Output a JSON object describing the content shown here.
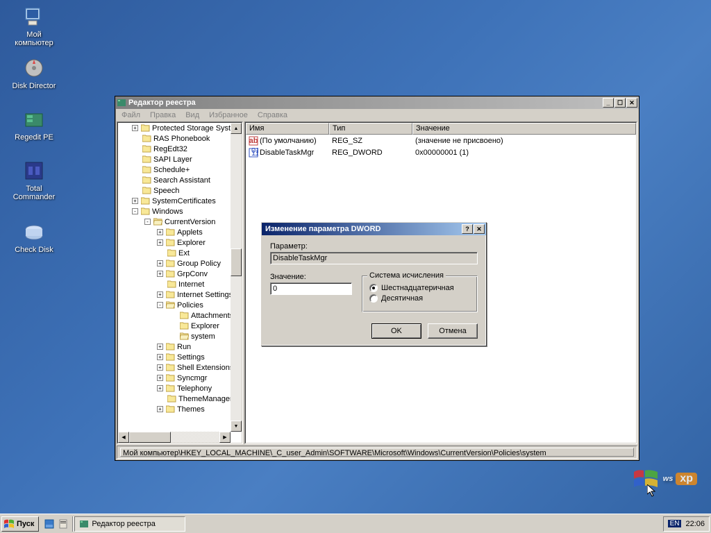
{
  "desktop_icons": [
    {
      "id": "my-computer",
      "label": "Мой\nкомпьютер"
    },
    {
      "id": "disk-director",
      "label": "Disk Director"
    },
    {
      "id": "regedit-pe",
      "label": "Regedit PE"
    },
    {
      "id": "total-commander",
      "label": "Total\nCommander"
    },
    {
      "id": "check-disk",
      "label": "Check Disk"
    }
  ],
  "regedit": {
    "title": "Редактор реестра",
    "menu": [
      "Файл",
      "Правка",
      "Вид",
      "Избранное",
      "Справка"
    ],
    "tree": [
      {
        "pad": 20,
        "exp": "+",
        "label": "Protected Storage System"
      },
      {
        "pad": 20,
        "exp": "",
        "label": "RAS Phonebook"
      },
      {
        "pad": 20,
        "exp": "",
        "label": "RegEdt32"
      },
      {
        "pad": 20,
        "exp": "",
        "label": "SAPI Layer"
      },
      {
        "pad": 20,
        "exp": "",
        "label": "Schedule+"
      },
      {
        "pad": 20,
        "exp": "",
        "label": "Search Assistant"
      },
      {
        "pad": 20,
        "exp": "",
        "label": "Speech"
      },
      {
        "pad": 20,
        "exp": "+",
        "label": "SystemCertificates"
      },
      {
        "pad": 20,
        "exp": "-",
        "label": "Windows"
      },
      {
        "pad": 38,
        "exp": "-",
        "label": "CurrentVersion",
        "open": true
      },
      {
        "pad": 56,
        "exp": "+",
        "label": "Applets"
      },
      {
        "pad": 56,
        "exp": "+",
        "label": "Explorer"
      },
      {
        "pad": 56,
        "exp": "",
        "label": "Ext"
      },
      {
        "pad": 56,
        "exp": "+",
        "label": "Group Policy"
      },
      {
        "pad": 56,
        "exp": "+",
        "label": "GrpConv"
      },
      {
        "pad": 56,
        "exp": "",
        "label": "Internet"
      },
      {
        "pad": 56,
        "exp": "+",
        "label": "Internet Settings"
      },
      {
        "pad": 56,
        "exp": "-",
        "label": "Policies",
        "open": true
      },
      {
        "pad": 74,
        "exp": "",
        "label": "Attachments"
      },
      {
        "pad": 74,
        "exp": "",
        "label": "Explorer"
      },
      {
        "pad": 74,
        "exp": "",
        "label": "system",
        "open": true
      },
      {
        "pad": 56,
        "exp": "+",
        "label": "Run"
      },
      {
        "pad": 56,
        "exp": "+",
        "label": "Settings"
      },
      {
        "pad": 56,
        "exp": "+",
        "label": "Shell Extensions"
      },
      {
        "pad": 56,
        "exp": "+",
        "label": "Syncmgr"
      },
      {
        "pad": 56,
        "exp": "+",
        "label": "Telephony"
      },
      {
        "pad": 56,
        "exp": "",
        "label": "ThemeManager"
      },
      {
        "pad": 56,
        "exp": "+",
        "label": "Themes"
      }
    ],
    "columns": {
      "name": "Имя",
      "type": "Тип",
      "value": "Значение"
    },
    "col_widths": {
      "name": 120,
      "type": 120,
      "value": 280
    },
    "rows": [
      {
        "icon": "sz",
        "name": "(По умолчанию)",
        "type": "REG_SZ",
        "value": "(значение не присвоено)"
      },
      {
        "icon": "dw",
        "name": "DisableTaskMgr",
        "type": "REG_DWORD",
        "value": "0x00000001 (1)"
      }
    ],
    "status": "Мой компьютер\\HKEY_LOCAL_MACHINE\\_C_user_Admin\\SOFTWARE\\Microsoft\\Windows\\CurrentVersion\\Policies\\system"
  },
  "dialog": {
    "title": "Изменение параметра DWORD",
    "param_label": "Параметр:",
    "param_value": "DisableTaskMgr",
    "value_label": "Значение:",
    "value_input": "0",
    "group_label": "Система исчисления",
    "radio_hex": "Шестнадцатеричная",
    "radio_dec": "Десятичная",
    "selected_radio": "hex",
    "ok": "OK",
    "cancel": "Отмена"
  },
  "taskbar": {
    "start": "Пуск",
    "task": "Редактор реестра",
    "lang": "EN",
    "clock": "22:06"
  },
  "branding": {
    "os": "ws",
    "suffix": "xp"
  }
}
